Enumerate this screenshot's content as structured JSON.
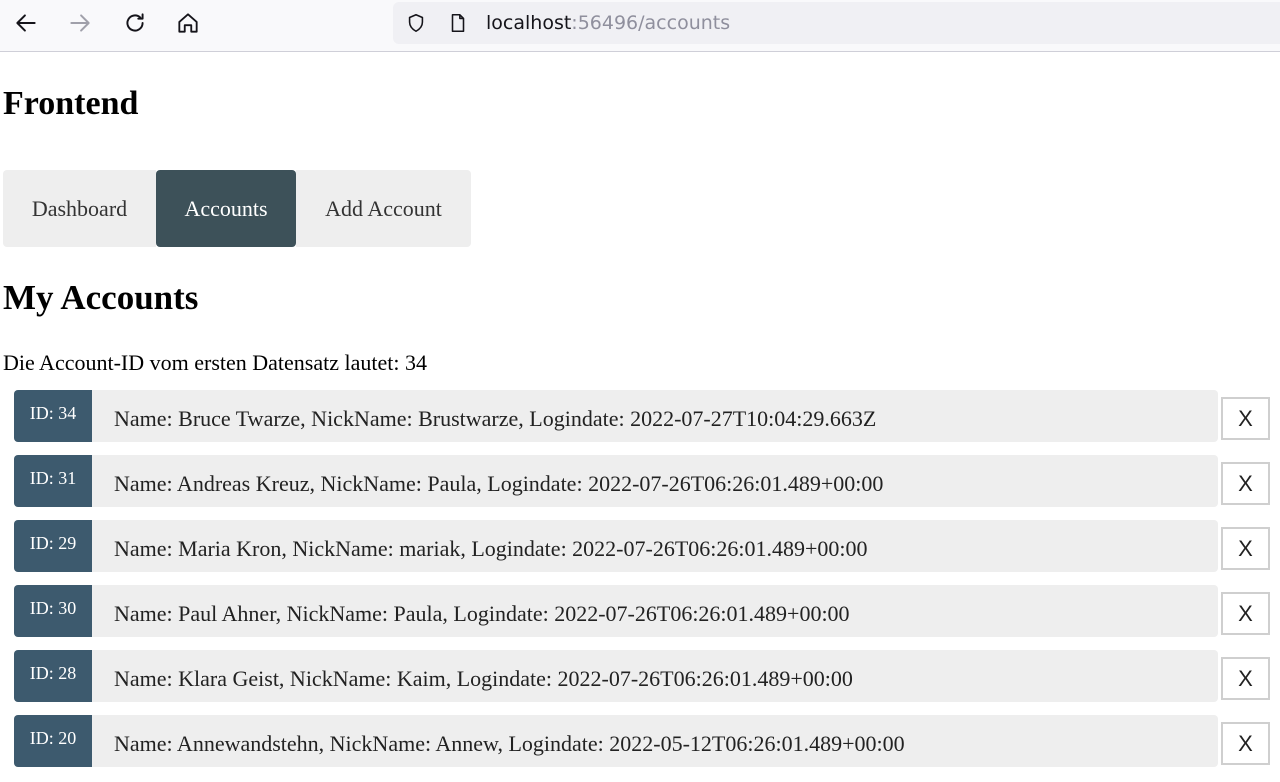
{
  "browser": {
    "url_host": "localhost",
    "url_rest": ":56496/accounts"
  },
  "app": {
    "title": "Frontend"
  },
  "nav": {
    "tabs": [
      {
        "label": "Dashboard",
        "active": false
      },
      {
        "label": "Accounts",
        "active": true
      },
      {
        "label": "Add Account",
        "active": false
      }
    ]
  },
  "accounts_page": {
    "title": "My Accounts",
    "first_id_text": "Die Account-ID vom ersten Datensatz lautet: 34",
    "delete_label": "X",
    "rows": [
      {
        "id": "ID: 34",
        "text": "Name: Bruce Twarze, NickName: Brustwarze, Logindate: 2022-07-27T10:04:29.663Z"
      },
      {
        "id": "ID: 31",
        "text": "Name: Andreas Kreuz, NickName: Paula, Logindate: 2022-07-26T06:26:01.489+00:00"
      },
      {
        "id": "ID: 29",
        "text": "Name: Maria Kron, NickName: mariak, Logindate: 2022-07-26T06:26:01.489+00:00"
      },
      {
        "id": "ID: 30",
        "text": "Name: Paul Ahner, NickName: Paula, Logindate: 2022-07-26T06:26:01.489+00:00"
      },
      {
        "id": "ID: 28",
        "text": "Name: Klara Geist, NickName: Kaim, Logindate: 2022-07-26T06:26:01.489+00:00"
      },
      {
        "id": "ID: 20",
        "text": "Name: Annewandstehn, NickName: Annew, Logindate: 2022-05-12T06:26:01.489+00:00"
      }
    ]
  },
  "colors": {
    "active_tab": "#3d5159",
    "id_badge": "#3d5a6e",
    "card_bg": "#eeeeee"
  }
}
